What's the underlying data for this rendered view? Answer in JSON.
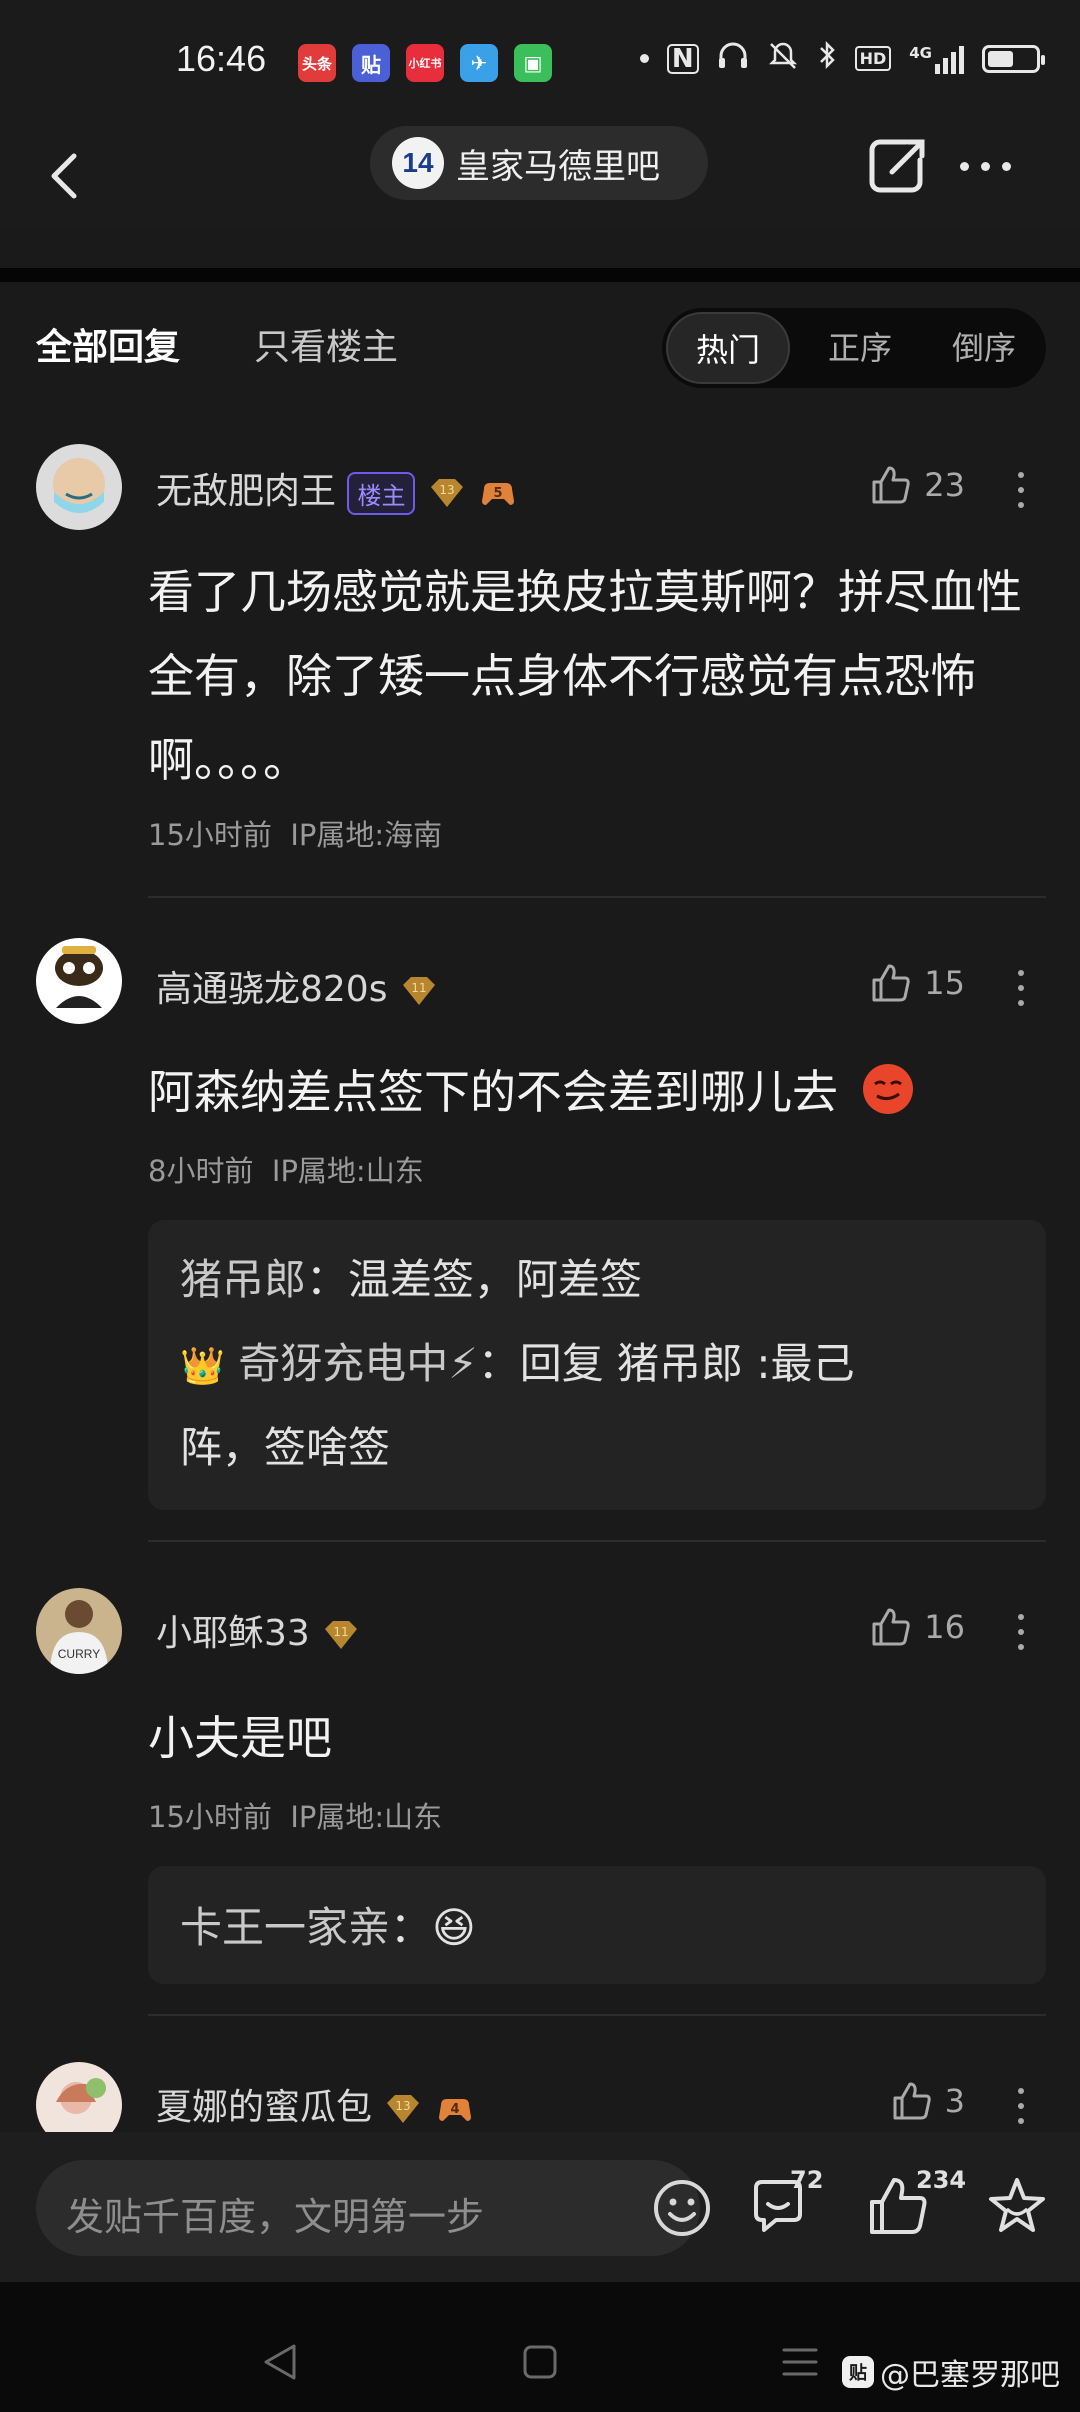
{
  "status_bar": {
    "time": "16:46",
    "apps": [
      {
        "label": "头条",
        "color": "#e23b3b"
      },
      {
        "label": "贴",
        "color": "#4b5fd6"
      },
      {
        "label": "小红书",
        "color": "#e82d3c"
      },
      {
        "label": "✈",
        "color": "#3aa0e8"
      },
      {
        "label": "▣",
        "color": "#3bbf5a"
      }
    ],
    "network": "4G",
    "hd": "HD",
    "battery_level": 0.55
  },
  "nav": {
    "forum_badge": "14",
    "forum_name": "皇家马德里吧"
  },
  "tabs": {
    "all_replies": "全部回复",
    "op_only": "只看楼主",
    "sort_hot": "热门",
    "sort_asc": "正序",
    "sort_desc": "倒序"
  },
  "posts": [
    {
      "username": "无敌肥肉王",
      "op_tag": "楼主",
      "level": "13",
      "game_level": "5",
      "likes": "23",
      "content": "看了几场感觉就是换皮拉莫斯啊？拼尽血性全有，除了矮一点身体不行感觉有点恐怖啊。。。。",
      "time": "15小时前",
      "ip": "IP属地:海南"
    },
    {
      "username": "高通骁龙820s",
      "level": "11",
      "likes": "15",
      "content": "阿森纳差点签下的不会差到哪儿去",
      "time": "8小时前",
      "ip": "IP属地:山东",
      "replies": [
        {
          "name": "猪吊郎",
          "sep": "：",
          "text": "温差签，阿差签"
        },
        {
          "crown": "👑",
          "name": "奇犽充电中⚡",
          "sep": "：",
          "text": "回复 猪吊郎 :最己",
          "text2": "阵，签啥签"
        }
      ]
    },
    {
      "username": "小耶稣33",
      "level": "11",
      "likes": "16",
      "content": "小夫是吧",
      "time": "15小时前",
      "ip": "IP属地:山东",
      "replies": [
        {
          "name": "卡王一家亲",
          "sep": "：",
          "text": "😆"
        }
      ]
    },
    {
      "username": "夏娜的蜜瓜包",
      "level": "13",
      "game_level": "4",
      "likes": "3"
    }
  ],
  "bottom_bar": {
    "placeholder": "发贴千百度，文明第一步",
    "comments_count": "72",
    "likes_count": "234"
  },
  "watermark": {
    "logo": "贴",
    "text": "@巴塞罗那吧"
  }
}
